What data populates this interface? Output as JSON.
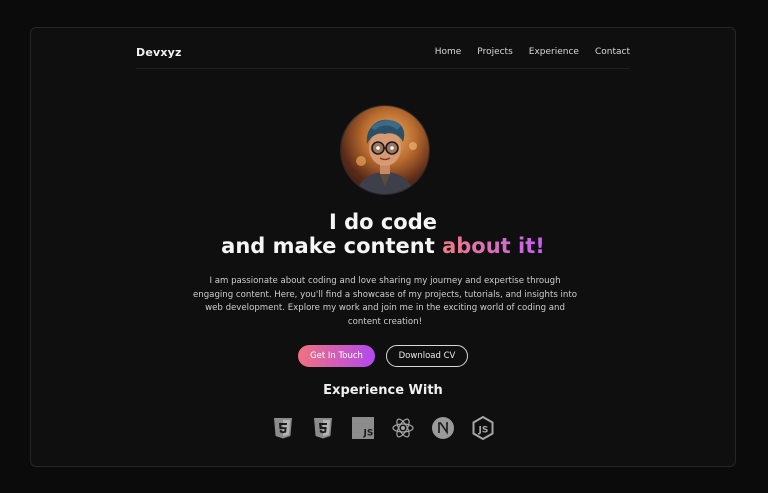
{
  "nav": {
    "brand": "Devxyz",
    "links": [
      "Home",
      "Projects",
      "Experience",
      "Contact"
    ]
  },
  "hero": {
    "line1": "I do code",
    "line2_plain": "and make content ",
    "line2_highlight": "about it!",
    "description": "I am passionate about coding and love sharing my journey and expertise through engaging content. Here, you'll find a showcase of my projects, tutorials, and insights into web development. Explore my work and join me in the exciting world of coding and content creation!",
    "primary_button": "Get In Touch",
    "secondary_button": "Download CV"
  },
  "experience": {
    "title": "Experience With",
    "icons": [
      "html5-icon",
      "css3-icon",
      "javascript-icon",
      "react-icon",
      "nextjs-icon",
      "nodejs-icon"
    ]
  },
  "colors": {
    "background": "#0b0b0b",
    "gradient_start": "#f07b85",
    "gradient_end": "#c361f5"
  }
}
